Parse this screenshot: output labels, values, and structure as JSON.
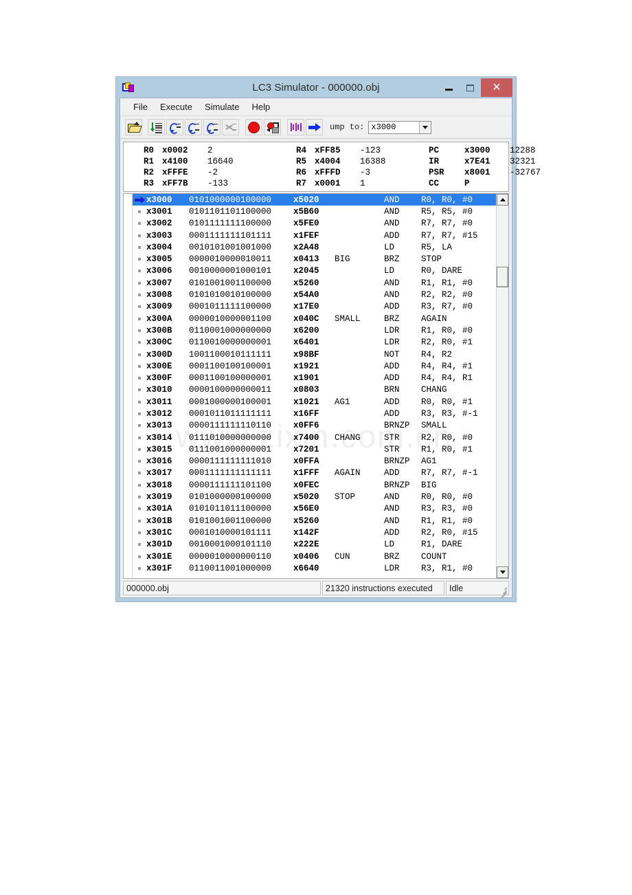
{
  "window": {
    "title": "LC3 Simulator - 000000.obj",
    "icon": "app-icon",
    "minimize_label": "",
    "maximize_label": "",
    "close_label": "✕"
  },
  "menu": {
    "items": [
      "File",
      "Execute",
      "Simulate",
      "Help"
    ]
  },
  "toolbar": {
    "buttons": [
      {
        "name": "open-file-button",
        "icon": "open-folder-icon"
      },
      {
        "name": "step-into-button",
        "icon": "step-list-icon"
      },
      {
        "name": "step-over-button",
        "icon": "step-curve-equals-icon"
      },
      {
        "name": "step-out-button",
        "icon": "step-curve-up-icon"
      },
      {
        "name": "step-back-button",
        "icon": "step-curve-down-icon"
      },
      {
        "name": "finish-button",
        "icon": "finish-cross-icon"
      },
      {
        "name": "stop-button",
        "icon": "stop-circle-icon"
      },
      {
        "name": "breakpoints-button",
        "icon": "breakpoint-list-icon"
      },
      {
        "name": "registers-button",
        "icon": "purple-bars-icon"
      },
      {
        "name": "run-button",
        "icon": "blue-right-arrow-icon"
      }
    ],
    "jump_label": "ump to:",
    "jump_value": "x3000",
    "jump_dropdown_icon": "chevron-down-icon"
  },
  "registers": {
    "rows": [
      {
        "c1": {
          "name": "R0",
          "hex": "x0002",
          "dec": "2"
        },
        "c2": {
          "name": "R4",
          "hex": "xFF85",
          "dec": "-123"
        },
        "c3": {
          "name": "PC",
          "hex": "x3000",
          "dec": "12288"
        }
      },
      {
        "c1": {
          "name": "R1",
          "hex": "x4100",
          "dec": "16640"
        },
        "c2": {
          "name": "R5",
          "hex": "x4004",
          "dec": "16388"
        },
        "c3": {
          "name": "IR",
          "hex": "x7E41",
          "dec": "32321"
        }
      },
      {
        "c1": {
          "name": "R2",
          "hex": "xFFFE",
          "dec": "-2"
        },
        "c2": {
          "name": "R6",
          "hex": "xFFFD",
          "dec": "-3"
        },
        "c3": {
          "name": "PSR",
          "hex": "x8001",
          "dec": "-32767"
        }
      },
      {
        "c1": {
          "name": "R3",
          "hex": "xFF7B",
          "dec": "-133"
        },
        "c2": {
          "name": "R7",
          "hex": "x0001",
          "dec": "1"
        },
        "c3": {
          "name": "CC",
          "hex": "P",
          "dec": ""
        }
      }
    ]
  },
  "listing": {
    "watermark": "www.zixin.com.cn",
    "rows": [
      {
        "marker": "pc-arrow",
        "addr": "x3000",
        "bin": "0101000000100000",
        "hex": "x5020",
        "label": "",
        "op": "AND",
        "args": "R0, R0, #0",
        "selected": true
      },
      {
        "marker": "breakpoint-slot",
        "addr": "x3001",
        "bin": "0101101101100000",
        "hex": "x5B60",
        "label": "",
        "op": "AND",
        "args": "R5, R5, #0",
        "selected": false
      },
      {
        "marker": "breakpoint-slot",
        "addr": "x3002",
        "bin": "0101111111100000",
        "hex": "x5FE0",
        "label": "",
        "op": "AND",
        "args": "R7, R7, #0",
        "selected": false
      },
      {
        "marker": "breakpoint-slot",
        "addr": "x3003",
        "bin": "0001111111101111",
        "hex": "x1FEF",
        "label": "",
        "op": "ADD",
        "args": "R7, R7, #15",
        "selected": false
      },
      {
        "marker": "breakpoint-slot",
        "addr": "x3004",
        "bin": "0010101001001000",
        "hex": "x2A48",
        "label": "",
        "op": "LD",
        "args": "R5, LA",
        "selected": false
      },
      {
        "marker": "breakpoint-slot",
        "addr": "x3005",
        "bin": "0000010000010011",
        "hex": "x0413",
        "label": "BIG",
        "op": "BRZ",
        "args": "STOP",
        "selected": false
      },
      {
        "marker": "breakpoint-slot",
        "addr": "x3006",
        "bin": "0010000001000101",
        "hex": "x2045",
        "label": "",
        "op": "LD",
        "args": "R0, DARE",
        "selected": false
      },
      {
        "marker": "breakpoint-slot",
        "addr": "x3007",
        "bin": "0101001001100000",
        "hex": "x5260",
        "label": "",
        "op": "AND",
        "args": "R1, R1, #0",
        "selected": false
      },
      {
        "marker": "breakpoint-slot",
        "addr": "x3008",
        "bin": "0101010010100000",
        "hex": "x54A0",
        "label": "",
        "op": "AND",
        "args": "R2, R2, #0",
        "selected": false
      },
      {
        "marker": "breakpoint-slot",
        "addr": "x3009",
        "bin": "0001011111100000",
        "hex": "x17E0",
        "label": "",
        "op": "ADD",
        "args": "R3, R7, #0",
        "selected": false
      },
      {
        "marker": "breakpoint-slot",
        "addr": "x300A",
        "bin": "0000010000001100",
        "hex": "x040C",
        "label": "SMALL",
        "op": "BRZ",
        "args": "AGAIN",
        "selected": false
      },
      {
        "marker": "breakpoint-slot",
        "addr": "x300B",
        "bin": "0110001000000000",
        "hex": "x6200",
        "label": "",
        "op": "LDR",
        "args": "R1, R0, #0",
        "selected": false
      },
      {
        "marker": "breakpoint-slot",
        "addr": "x300C",
        "bin": "0110010000000001",
        "hex": "x6401",
        "label": "",
        "op": "LDR",
        "args": "R2, R0, #1",
        "selected": false
      },
      {
        "marker": "breakpoint-slot",
        "addr": "x300D",
        "bin": "1001100010111111",
        "hex": "x98BF",
        "label": "",
        "op": "NOT",
        "args": "R4, R2",
        "selected": false
      },
      {
        "marker": "breakpoint-slot",
        "addr": "x300E",
        "bin": "0001100100100001",
        "hex": "x1921",
        "label": "",
        "op": "ADD",
        "args": "R4, R4, #1",
        "selected": false
      },
      {
        "marker": "breakpoint-slot",
        "addr": "x300F",
        "bin": "0001100100000001",
        "hex": "x1901",
        "label": "",
        "op": "ADD",
        "args": "R4, R4, R1",
        "selected": false
      },
      {
        "marker": "breakpoint-slot",
        "addr": "x3010",
        "bin": "0000100000000011",
        "hex": "x0803",
        "label": "",
        "op": "BRN",
        "args": "CHANG",
        "selected": false
      },
      {
        "marker": "breakpoint-slot",
        "addr": "x3011",
        "bin": "0001000000100001",
        "hex": "x1021",
        "label": "AG1",
        "op": "ADD",
        "args": "R0, R0, #1",
        "selected": false
      },
      {
        "marker": "breakpoint-slot",
        "addr": "x3012",
        "bin": "0001011011111111",
        "hex": "x16FF",
        "label": "",
        "op": "ADD",
        "args": "R3, R3, #-1",
        "selected": false
      },
      {
        "marker": "breakpoint-slot",
        "addr": "x3013",
        "bin": "0000111111110110",
        "hex": "x0FF6",
        "label": "",
        "op": "BRNZP",
        "args": "SMALL",
        "selected": false
      },
      {
        "marker": "breakpoint-slot",
        "addr": "x3014",
        "bin": "0111010000000000",
        "hex": "x7400",
        "label": "CHANG",
        "op": "STR",
        "args": "R2, R0, #0",
        "selected": false
      },
      {
        "marker": "breakpoint-slot",
        "addr": "x3015",
        "bin": "0111001000000001",
        "hex": "x7201",
        "label": "",
        "op": "STR",
        "args": "R1, R0, #1",
        "selected": false
      },
      {
        "marker": "breakpoint-slot",
        "addr": "x3016",
        "bin": "0000111111111010",
        "hex": "x0FFA",
        "label": "",
        "op": "BRNZP",
        "args": "AG1",
        "selected": false
      },
      {
        "marker": "breakpoint-slot",
        "addr": "x3017",
        "bin": "0001111111111111",
        "hex": "x1FFF",
        "label": "AGAIN",
        "op": "ADD",
        "args": "R7, R7, #-1",
        "selected": false
      },
      {
        "marker": "breakpoint-slot",
        "addr": "x3018",
        "bin": "0000111111101100",
        "hex": "x0FEC",
        "label": "",
        "op": "BRNZP",
        "args": "BIG",
        "selected": false
      },
      {
        "marker": "breakpoint-slot",
        "addr": "x3019",
        "bin": "0101000000100000",
        "hex": "x5020",
        "label": "STOP",
        "op": "AND",
        "args": "R0, R0, #0",
        "selected": false
      },
      {
        "marker": "breakpoint-slot",
        "addr": "x301A",
        "bin": "0101011011100000",
        "hex": "x56E0",
        "label": "",
        "op": "AND",
        "args": "R3, R3, #0",
        "selected": false
      },
      {
        "marker": "breakpoint-slot",
        "addr": "x301B",
        "bin": "0101001001100000",
        "hex": "x5260",
        "label": "",
        "op": "AND",
        "args": "R1, R1, #0",
        "selected": false
      },
      {
        "marker": "breakpoint-slot",
        "addr": "x301C",
        "bin": "0001010000101111",
        "hex": "x142F",
        "label": "",
        "op": "ADD",
        "args": "R2, R0, #15",
        "selected": false
      },
      {
        "marker": "breakpoint-slot",
        "addr": "x301D",
        "bin": "0010001000101110",
        "hex": "x222E",
        "label": "",
        "op": "LD",
        "args": "R1, DARE",
        "selected": false
      },
      {
        "marker": "breakpoint-slot",
        "addr": "x301E",
        "bin": "0000010000000110",
        "hex": "x0406",
        "label": "CUN",
        "op": "BRZ",
        "args": "COUNT",
        "selected": false
      },
      {
        "marker": "breakpoint-slot",
        "addr": "x301F",
        "bin": "0110011001000000",
        "hex": "x6640",
        "label": "",
        "op": "LDR",
        "args": "R3, R1, #0",
        "selected": false
      }
    ]
  },
  "scrollbar": {
    "up_icon": "scroll-up-arrow-icon",
    "down_icon": "scroll-down-arrow-icon",
    "thumb_position_percent": 17
  },
  "status_bar": {
    "file": "000000.obj",
    "message": "21320 instructions executed",
    "state": "Idle"
  },
  "colors": {
    "frame": "#b3cde0",
    "selection": "#2a7fe8",
    "close_button": "#c75b5b",
    "pc_arrow": "#1a1ad0",
    "stop_icon": "#e81010"
  }
}
